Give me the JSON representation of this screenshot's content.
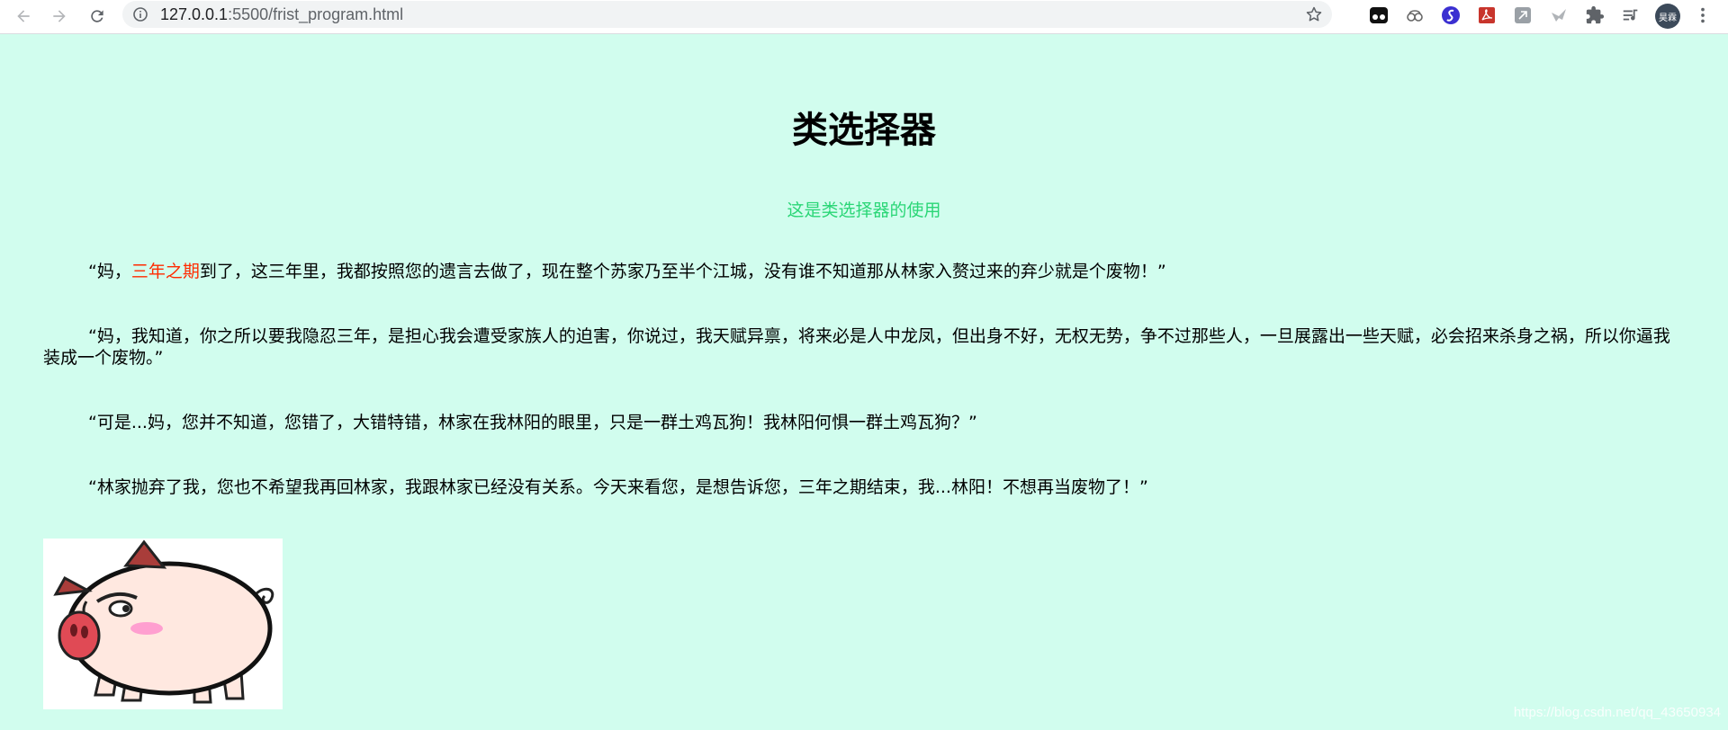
{
  "browser": {
    "url_host": "127.0.0.1",
    "url_path": ":5500/frist_program.html",
    "avatar_text": "昊霖"
  },
  "page": {
    "title": "类选择器",
    "subtitle": "这是类选择器的使用",
    "p1_before": "“妈，",
    "p1_highlight": "三年之期",
    "p1_after": "到了，这三年里，我都按照您的遗言去做了，现在整个苏家乃至半个江城，没有谁不知道那从林家入赘过来的弃少就是个废物！”",
    "p2": "“妈，我知道，你之所以要我隐忍三年，是担心我会遭受家族人的迫害，你说过，我天赋异禀，将来必是人中龙凤，但出身不好，无权无势，争不过那些人，一旦展露出一些天赋，必会招来杀身之祸，所以你逼我装成一个废物。”",
    "p3": "“可是...妈，您并不知道，您错了，大错特错，林家在我林阳的眼里，只是一群土鸡瓦狗！我林阳何惧一群土鸡瓦狗？”",
    "p4": "“林家抛弃了我，您也不希望我再回林家，我跟林家已经没有关系。今天来看您，是想告诉您，三年之期结束，我...林阳！不想再当废物了！”",
    "highlight_color": "#ff2a00",
    "subtitle_color": "#2ad676",
    "background_color": "#d1fdee"
  },
  "watermark": "https://blog.csdn.net/qq_43650934"
}
